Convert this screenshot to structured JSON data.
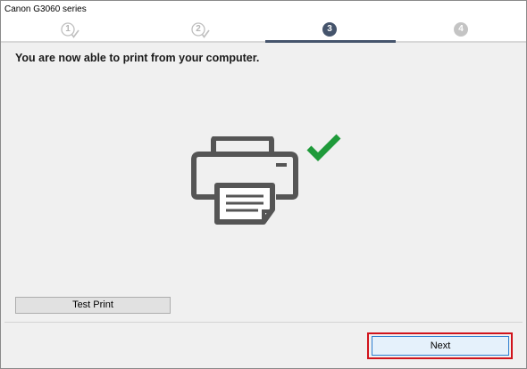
{
  "window": {
    "title": "Canon G3060 series"
  },
  "steps": [
    {
      "number": "1",
      "state": "completed"
    },
    {
      "number": "2",
      "state": "completed"
    },
    {
      "number": "3",
      "state": "current"
    },
    {
      "number": "4",
      "state": "upcoming"
    }
  ],
  "main": {
    "message": "You are now able to print from your computer.",
    "illustration_icons": [
      "printer-icon",
      "checkmark-icon"
    ]
  },
  "buttons": {
    "test_print_label": "Test Print",
    "next_label": "Next"
  },
  "colors": {
    "active_step": "#45546c",
    "inactive_step": "#c4c4c4",
    "checkmark": "#1f9a3a",
    "printer": "#555555",
    "highlight_border": "#d1141c",
    "default_button_border": "#2d7fd0"
  }
}
